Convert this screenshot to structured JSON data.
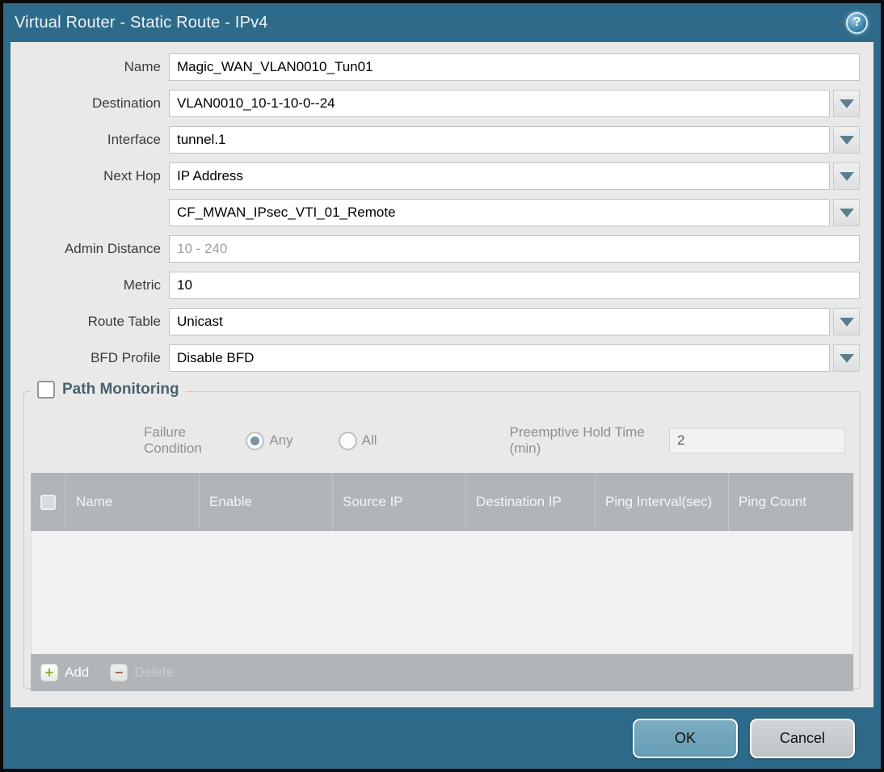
{
  "window": {
    "title": "Virtual Router - Static Route - IPv4",
    "help_glyph": "?"
  },
  "form": {
    "name": {
      "label": "Name",
      "value": "Magic_WAN_VLAN0010_Tun01"
    },
    "destination": {
      "label": "Destination",
      "value": "VLAN0010_10-1-10-0--24"
    },
    "interface": {
      "label": "Interface",
      "value": "tunnel.1"
    },
    "next_hop": {
      "label": "Next Hop",
      "value": "IP Address"
    },
    "next_hop_address": {
      "value": "CF_MWAN_IPsec_VTI_01_Remote"
    },
    "admin_distance": {
      "label": "Admin Distance",
      "value": "",
      "placeholder": "10 - 240"
    },
    "metric": {
      "label": "Metric",
      "value": "10"
    },
    "route_table": {
      "label": "Route Table",
      "value": "Unicast"
    },
    "bfd_profile": {
      "label": "BFD Profile",
      "value": "Disable BFD"
    }
  },
  "path_monitoring": {
    "title": "Path Monitoring",
    "checked": false,
    "failure_condition": {
      "label": "Failure Condition",
      "options": [
        {
          "label": "Any",
          "selected": true
        },
        {
          "label": "All",
          "selected": false
        }
      ]
    },
    "preemptive_hold_time": {
      "label": "Preemptive Hold Time (min)",
      "value": "2"
    },
    "table": {
      "headers": [
        "Name",
        "Enable",
        "Source IP",
        "Destination IP",
        "Ping Interval(sec)",
        "Ping Count"
      ],
      "rows": []
    },
    "add_label": "Add",
    "delete_label": "Delete",
    "add_glyph": "+",
    "delete_glyph": "−"
  },
  "footer": {
    "ok_label": "OK",
    "cancel_label": "Cancel"
  },
  "colors": {
    "titlebar": "#2e6b8b",
    "body": "#e9e9e9",
    "table_header": "#b1b5b8",
    "ok_button": "#6ba1b9",
    "cancel_button": "#c6c9cc",
    "add_plus": "#8fae3c",
    "delete_minus": "#a2665c",
    "radio_selected_dot": "#7396a6"
  }
}
